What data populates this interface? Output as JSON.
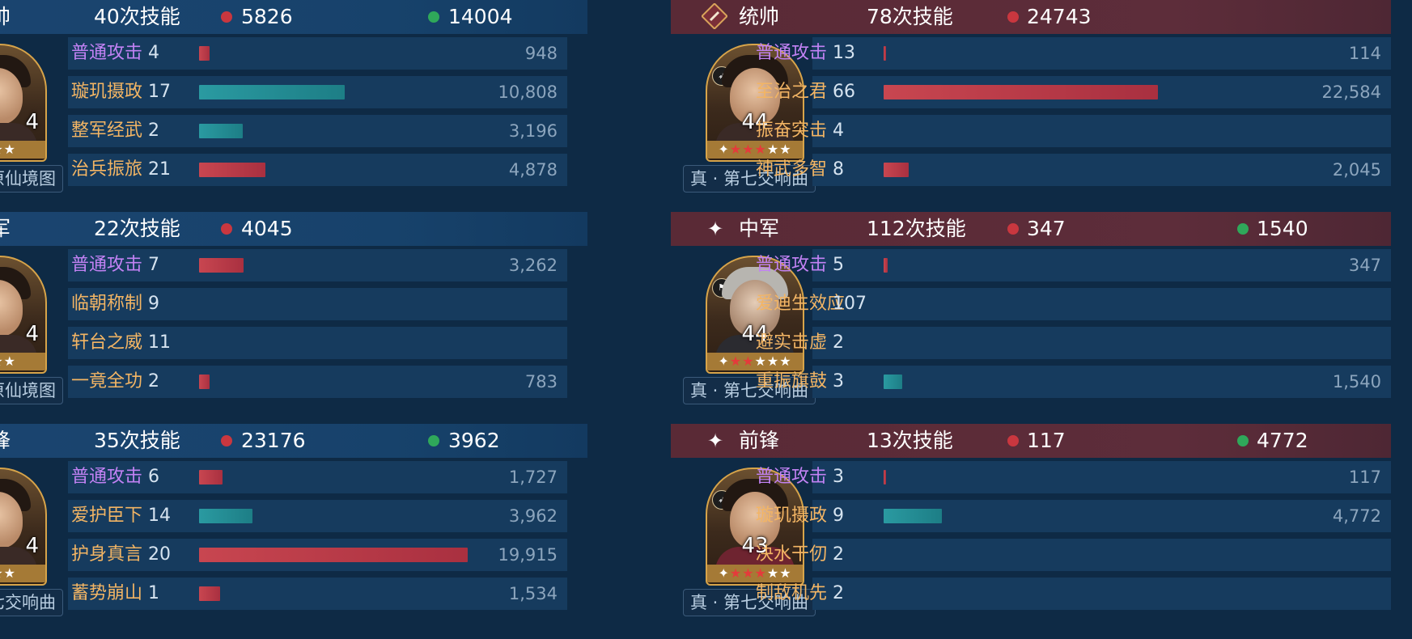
{
  "left": {
    "groups": [
      {
        "role": "帅",
        "skill_count": "40次技能",
        "red_value": "5826",
        "green_value": "14004",
        "level": "4",
        "stars": "★★★",
        "tactic": "原仙境图",
        "skills": [
          {
            "name": "普通攻击",
            "count": "4",
            "value": "948",
            "type": "red",
            "fraction": 0.026
          },
          {
            "name": "璇玑摄政",
            "count": "17",
            "value": "10,808",
            "type": "teal",
            "fraction": 0.36
          },
          {
            "name": "整军经武",
            "count": "2",
            "value": "3,196",
            "type": "teal",
            "fraction": 0.107
          },
          {
            "name": "治兵振旅",
            "count": "21",
            "value": "4,878",
            "type": "red",
            "fraction": 0.163
          }
        ]
      },
      {
        "role": "军",
        "skill_count": "22次技能",
        "red_value": "4045",
        "green_value": "",
        "level": "4",
        "stars": "★★★",
        "tactic": "原仙境图",
        "skills": [
          {
            "name": "普通攻击",
            "count": "7",
            "value": "3,262",
            "type": "red",
            "fraction": 0.109
          },
          {
            "name": "临朝称制",
            "count": "9",
            "value": "",
            "type": "none",
            "fraction": 0
          },
          {
            "name": "轩台之威",
            "count": "11",
            "value": "",
            "type": "none",
            "fraction": 0
          },
          {
            "name": "一竟全功",
            "count": "2",
            "value": "783",
            "type": "red",
            "fraction": 0.026
          }
        ]
      },
      {
        "role": "锋",
        "skill_count": "35次技能",
        "red_value": "23176",
        "green_value": "3962",
        "level": "4",
        "stars": "★★★",
        "tactic": "七交响曲",
        "skills": [
          {
            "name": "普通攻击",
            "count": "6",
            "value": "1,727",
            "type": "red",
            "fraction": 0.058
          },
          {
            "name": "爱护臣下",
            "count": "14",
            "value": "3,962",
            "type": "teal",
            "fraction": 0.132
          },
          {
            "name": "护身真言",
            "count": "20",
            "value": "19,915",
            "type": "red",
            "fraction": 0.664
          },
          {
            "name": "蓄势崩山",
            "count": "1",
            "value": "1,534",
            "type": "red",
            "fraction": 0.051
          }
        ]
      }
    ]
  },
  "right": {
    "groups": [
      {
        "role_icon": "sword-badge-icon",
        "role": "统帅",
        "skill_count": "78次技能",
        "red_value": "24743",
        "green_value": "",
        "level": "44",
        "tactic": "真 · 第七交响曲",
        "skills": [
          {
            "name": "普通攻击",
            "count": "13",
            "value": "114",
            "type": "red",
            "fraction": 0.005
          },
          {
            "name": "至治之君",
            "count": "66",
            "value": "22,584",
            "type": "red",
            "fraction": 0.75
          },
          {
            "name": "振奋突击",
            "count": "4",
            "value": "",
            "type": "none",
            "fraction": 0
          },
          {
            "name": "神武多智",
            "count": "8",
            "value": "2,045",
            "type": "red",
            "fraction": 0.068
          }
        ]
      },
      {
        "role_icon": "four-point-star-icon",
        "role": "中军",
        "skill_count": "112次技能",
        "red_value": "347",
        "green_value": "1540",
        "level": "44",
        "tactic": "真 · 第七交响曲",
        "skills": [
          {
            "name": "普通攻击",
            "count": "5",
            "value": "347",
            "type": "red",
            "fraction": 0.012
          },
          {
            "name": "爱迪生效应",
            "count": "107",
            "value": "",
            "type": "none",
            "fraction": 0
          },
          {
            "name": "避实击虚",
            "count": "2",
            "value": "",
            "type": "none",
            "fraction": 0
          },
          {
            "name": "重振旗鼓",
            "count": "3",
            "value": "1,540",
            "type": "teal",
            "fraction": 0.051
          }
        ]
      },
      {
        "role_icon": "four-point-star-icon",
        "role": "前锋",
        "skill_count": "13次技能",
        "red_value": "117",
        "green_value": "4772",
        "level": "43",
        "tactic": "真 · 第七交响曲",
        "skills": [
          {
            "name": "普通攻击",
            "count": "3",
            "value": "117",
            "type": "red",
            "fraction": 0.004
          },
          {
            "name": "璇玑摄政",
            "count": "9",
            "value": "4,772",
            "type": "teal",
            "fraction": 0.159
          },
          {
            "name": "决水干仞",
            "count": "2",
            "value": "",
            "type": "none",
            "fraction": 0
          },
          {
            "name": "制敌机先",
            "count": "2",
            "value": "",
            "type": "none",
            "fraction": 0
          }
        ]
      }
    ]
  },
  "colors": {
    "red_dot": "#c9373f",
    "green_dot": "#2fa85a",
    "skill_orange": "#f3b564",
    "skill_purple": "#c282f4"
  }
}
